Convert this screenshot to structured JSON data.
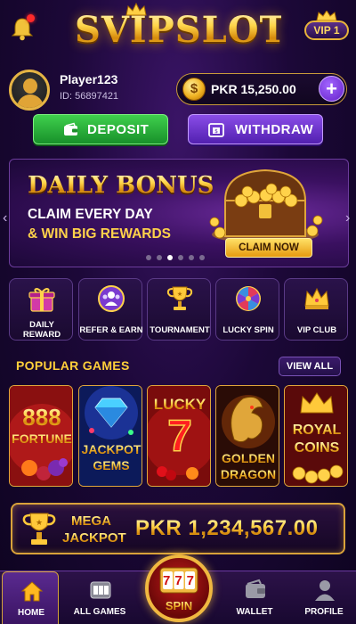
{
  "header": {
    "brand": "SVIPSLOT",
    "vip": "VIP 1"
  },
  "profile": {
    "name": "Player123",
    "id": "ID: 56897421"
  },
  "wallet": {
    "balance": "PKR 15,250.00",
    "coin_symbol": "$",
    "plus": "+"
  },
  "actions": {
    "deposit": "DEPOSIT",
    "withdraw": "WITHDRAW"
  },
  "banner": {
    "title": "DAILY BONUS",
    "line1": "CLAIM EVERY DAY",
    "line2": "& WIN BIG REWARDS",
    "cta": "CLAIM NOW",
    "slide_count": 6,
    "active_slide": 2
  },
  "categories": [
    {
      "label_1": "DAILY",
      "label_2": "REWARD",
      "icon": "gift-icon"
    },
    {
      "label_1": "REFER & EARN",
      "label_2": "",
      "icon": "refer-icon"
    },
    {
      "label_1": "TOURNAMENT",
      "label_2": "",
      "icon": "trophy-icon"
    },
    {
      "label_1": "LUCKY SPIN",
      "label_2": "",
      "icon": "wheel-icon"
    },
    {
      "label_1": "VIP CLUB",
      "label_2": "",
      "icon": "crown-icon"
    }
  ],
  "popular": {
    "title": "POPULAR GAMES",
    "view_all": "VIEW ALL",
    "games": [
      {
        "l1": "888",
        "l2": "FORTUNE"
      },
      {
        "l1": "JACKPOT",
        "l2": "GEMS"
      },
      {
        "l1": "LUCKY",
        "l2": "7"
      },
      {
        "l1": "GOLDEN",
        "l2": "DRAGON"
      },
      {
        "l1": "ROYAL",
        "l2": "COINS"
      }
    ]
  },
  "jackpot": {
    "l1": "MEGA",
    "l2": "JACKPOT",
    "amount": "PKR 1,234,567.00"
  },
  "nav": {
    "home": "HOME",
    "all_games": "ALL GAMES",
    "spin": "SPIN",
    "spin_reels": "777",
    "wallet": "WALLET",
    "profile": "PROFILE"
  },
  "colors": {
    "gold": "#ffd54a",
    "deposit": "#2fb83e",
    "withdraw": "#6e34d0",
    "bg": "#1c0838"
  }
}
